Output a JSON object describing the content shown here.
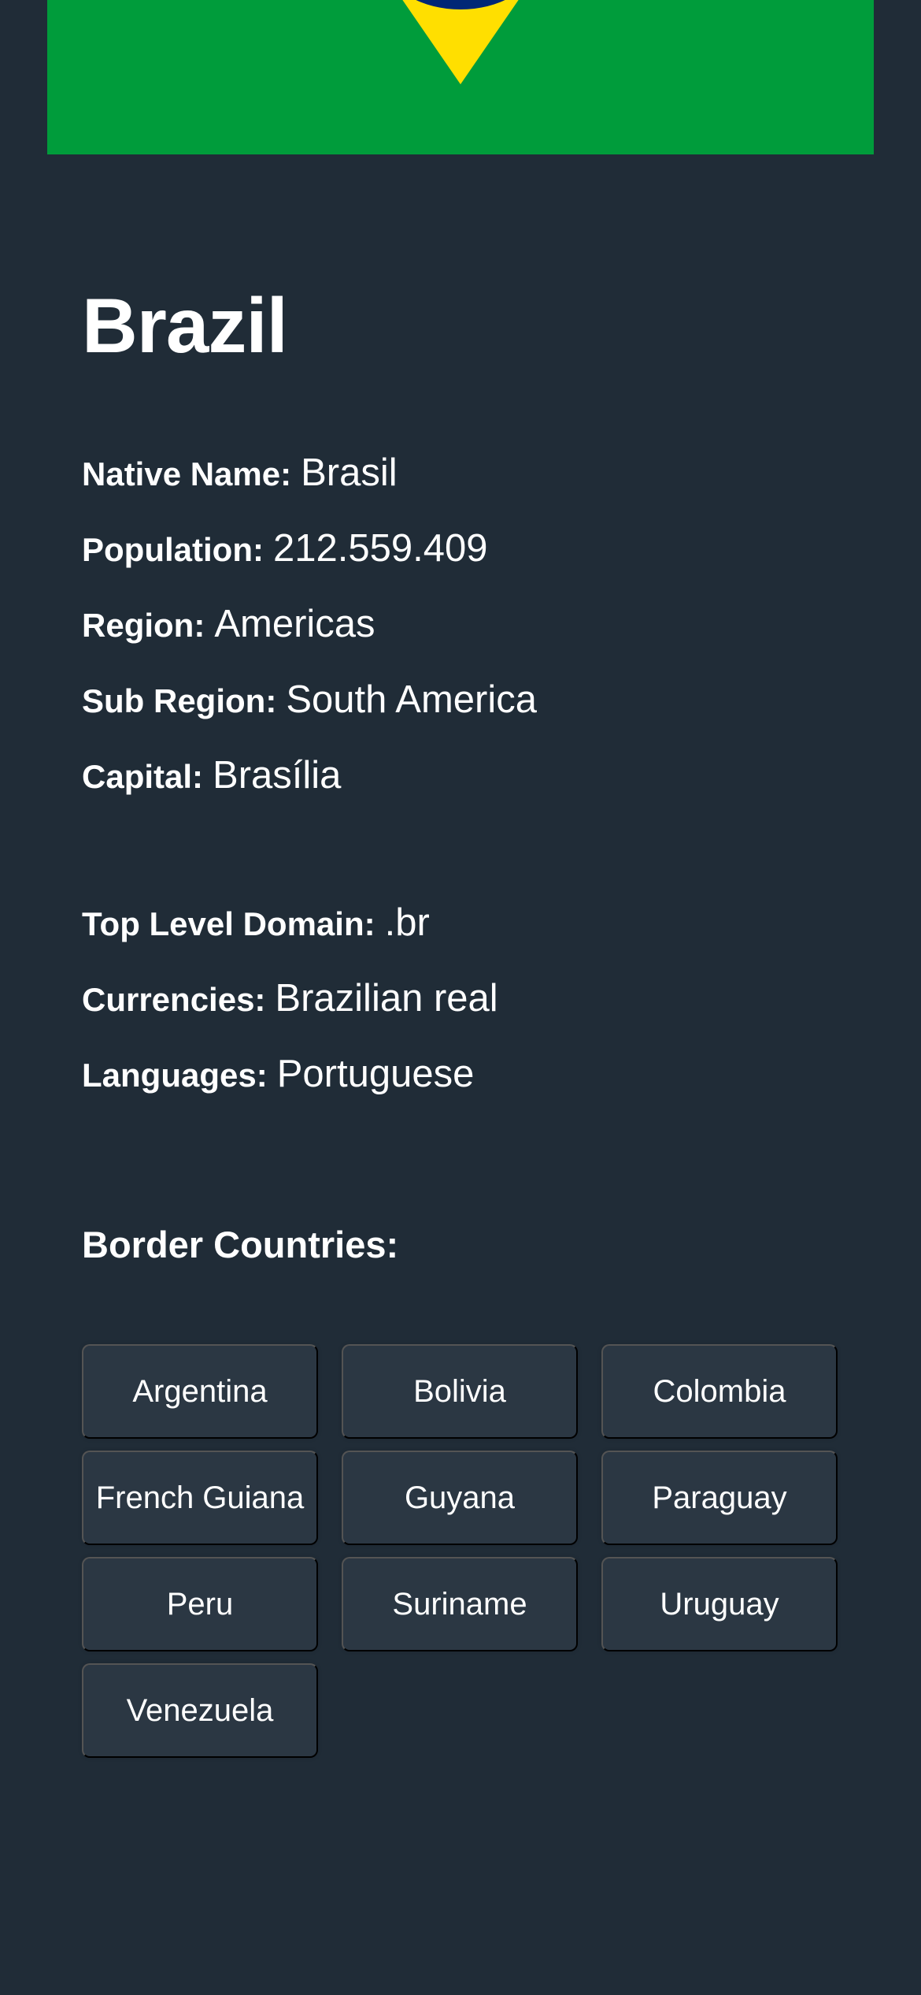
{
  "flag": {
    "icon": "brazil-flag-icon",
    "colors": {
      "green": "#009c3b",
      "yellow": "#ffdf00",
      "blue": "#002776"
    }
  },
  "country": {
    "name": "Brazil"
  },
  "details": {
    "native_name": {
      "label": "Native Name:",
      "value": "Brasil"
    },
    "population": {
      "label": "Population:",
      "value": "212.559.409"
    },
    "region": {
      "label": "Region:",
      "value": "Americas"
    },
    "sub_region": {
      "label": "Sub Region:",
      "value": "South America"
    },
    "capital": {
      "label": "Capital:",
      "value": "Brasília"
    },
    "tld": {
      "label": "Top Level Domain:",
      "value": ".br"
    },
    "currencies": {
      "label": "Currencies:",
      "value": "Brazilian real"
    },
    "languages": {
      "label": "Languages:",
      "value": "Portuguese"
    }
  },
  "borders": {
    "heading": "Border Countries:",
    "countries": [
      "Argentina",
      "Bolivia",
      "Colombia",
      "French Guiana",
      "Guyana",
      "Paraguay",
      "Peru",
      "Suriname",
      "Uruguay",
      "Venezuela"
    ]
  },
  "theme": {
    "background": "#202c37",
    "element": "#2b3743",
    "text": "#ffffff"
  }
}
